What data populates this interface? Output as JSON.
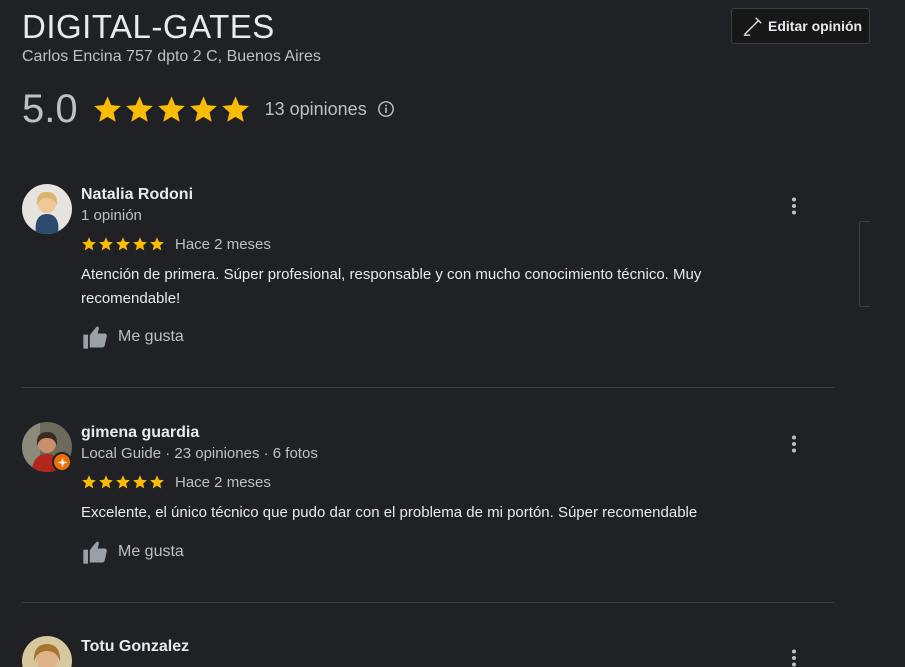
{
  "business": {
    "name": "DIGITAL-GATES",
    "address": "Carlos Encina 757 dpto 2 C, Buenos Aires",
    "rating": "5.0",
    "stars": 5,
    "review_count": "13 opiniones"
  },
  "edit_button": {
    "label": "Editar opinión",
    "icon": "pencil-icon"
  },
  "colors": {
    "background": "#202124",
    "star": "#fbbc04",
    "text": "#e8eaed",
    "muted": "#bdc1c6",
    "divider": "#3c4043",
    "local_guide_badge": "#e8710a"
  },
  "reviews": [
    {
      "name": "Natalia Rodoni",
      "meta": "1 opinión",
      "stars": 5,
      "date": "Hace 2 meses",
      "text": "Atención de primera. Súper profesional, responsable y con mucho conocimiento técnico. Muy recomendable!",
      "like_label": "Me gusta"
    },
    {
      "name": "gimena guardia",
      "meta": "Local Guide · 23 opiniones · 6 fotos",
      "stars": 5,
      "date": "Hace 2 meses",
      "text": "Excelente, el único técnico que pudo dar con el problema de mi portón. Súper recomendable",
      "like_label": "Me gusta"
    },
    {
      "name": "Totu Gonzalez"
    }
  ]
}
